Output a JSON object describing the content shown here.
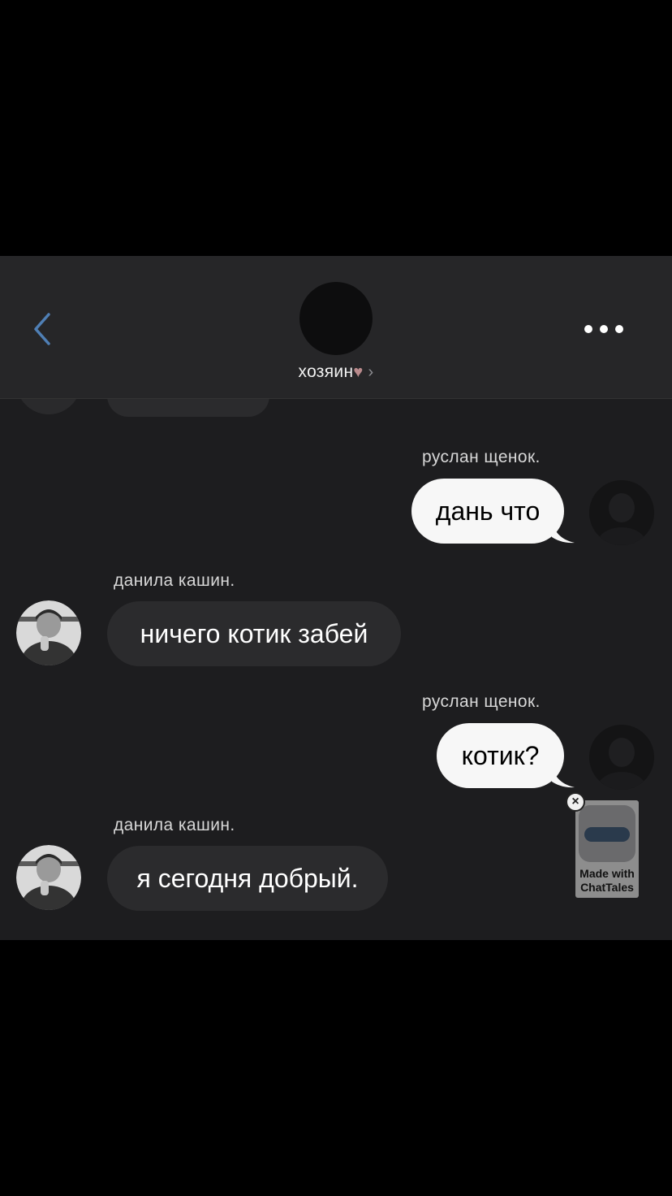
{
  "header": {
    "title": "хозяин",
    "heart": "♥",
    "chevron": "›"
  },
  "messages": [
    {
      "sender": "руслан щенок.",
      "text": "дань что",
      "side": "out"
    },
    {
      "sender": "данила кашин.",
      "text": "ничего котик забей",
      "side": "in"
    },
    {
      "sender": "руслан щенок.",
      "text": "котик?",
      "side": "out"
    },
    {
      "sender": "данила кашин.",
      "text": "я сегодня добрый.",
      "side": "in"
    }
  ],
  "badge": {
    "close": "×",
    "line1": "Made with",
    "line2": "ChatTales"
  }
}
